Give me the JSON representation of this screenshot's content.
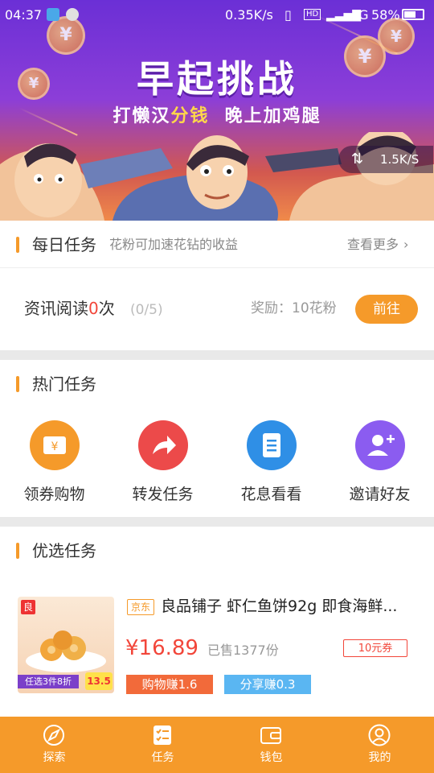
{
  "status_bar": {
    "time": "04:37",
    "net_speed": "0.35K/s",
    "network": "4G",
    "battery": "58%"
  },
  "banner": {
    "title": "早起挑战",
    "subtitle_a": "打懒汉",
    "subtitle_b": "分钱",
    "subtitle_c": "晚上加鸡腿",
    "speed": "1.5K/S",
    "coin_glyph": "¥"
  },
  "daily": {
    "title": "每日任务",
    "desc": "花粉可加速花钻的收益",
    "more": "查看更多",
    "task_name": "资讯阅读",
    "task_count": "0",
    "task_unit": "次",
    "task_progress": "(0/5)",
    "reward": "奖励：10花粉",
    "go_button": "前往"
  },
  "hot": {
    "title": "热门任务",
    "items": [
      {
        "label": "领券购物",
        "icon": "coupon-icon",
        "color": "#f59a2a"
      },
      {
        "label": "转发任务",
        "icon": "share-arrow-icon",
        "color": "#ec4a4a"
      },
      {
        "label": "花息看看",
        "icon": "document-icon",
        "color": "#2f8fe6"
      },
      {
        "label": "邀请好友",
        "icon": "add-friend-icon",
        "color": "#8b5cf0"
      }
    ]
  },
  "featured": {
    "title": "优选任务",
    "product": {
      "source_tag": "京东",
      "name": "良品铺子 虾仁鱼饼92g 即食海鲜...",
      "price": "¥16.89",
      "sold": "已售1377份",
      "coupon": "10元券",
      "earn_shop": "购物赚1.6",
      "earn_share": "分享赚0.3",
      "img_promo": "任选3件8折",
      "img_price": "13.5",
      "img_logo": "良"
    }
  },
  "tabbar": {
    "items": [
      {
        "label": "探索",
        "icon": "explore-icon"
      },
      {
        "label": "任务",
        "icon": "task-icon"
      },
      {
        "label": "钱包",
        "icon": "wallet-icon"
      },
      {
        "label": "我的",
        "icon": "profile-icon"
      }
    ]
  },
  "colors": {
    "accent": "#f59a2a",
    "red": "#f2463a",
    "share_blue": "#5ab6f2"
  }
}
